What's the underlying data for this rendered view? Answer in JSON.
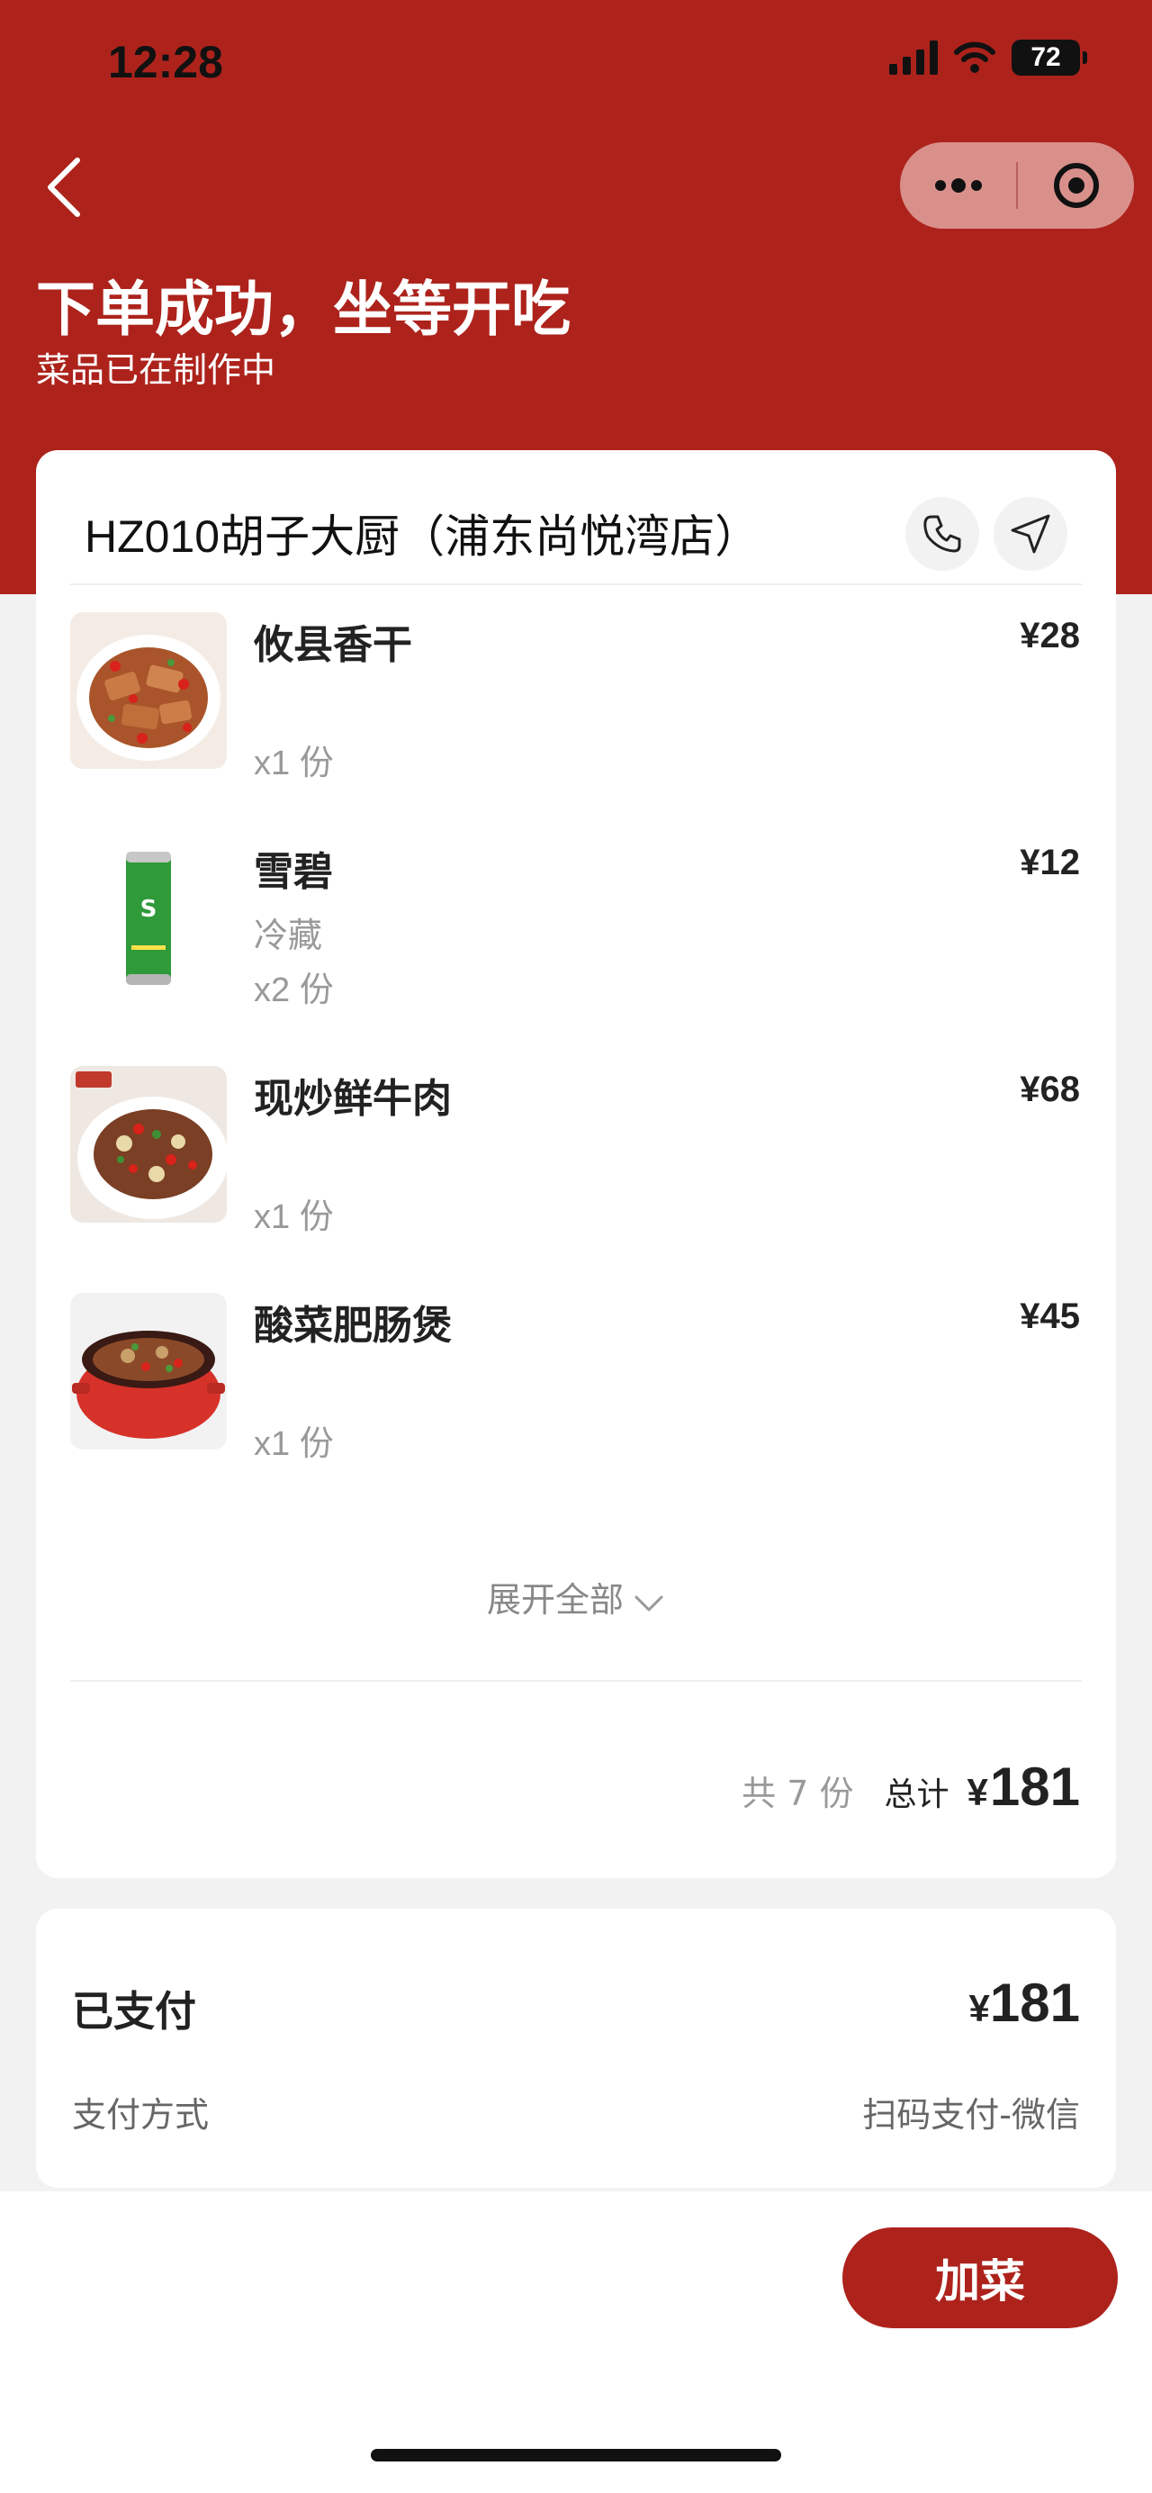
{
  "status_bar": {
    "time": "12:28",
    "battery": "72"
  },
  "header": {
    "title": "下单成功，坐等开吃",
    "subtitle": "菜品已在制作中"
  },
  "store": {
    "name": "HZ010胡子大厨（浦东尚悦湾店）"
  },
  "items": [
    {
      "name": "攸县香干",
      "spec": "",
      "qty": "x1 份",
      "price": "¥28"
    },
    {
      "name": "雪碧",
      "spec": "冷藏",
      "qty": "x2 份",
      "price": "¥12"
    },
    {
      "name": "现炒鲜牛肉",
      "spec": "",
      "qty": "x1 份",
      "price": "¥68"
    },
    {
      "name": "酸菜肥肠煲",
      "spec": "",
      "qty": "x1 份",
      "price": "¥45"
    }
  ],
  "expand_label": "展开全部",
  "summary": {
    "count": "共 7 份",
    "total_label": "总计",
    "currency": "¥",
    "total": "181"
  },
  "payment": {
    "status": "已支付",
    "currency": "¥",
    "amount": "181",
    "method_label": "支付方式",
    "method_value": "扫码支付-微信"
  },
  "actions": {
    "add_dish": "加菜"
  },
  "colors": {
    "brand_red": "#ad231c"
  }
}
